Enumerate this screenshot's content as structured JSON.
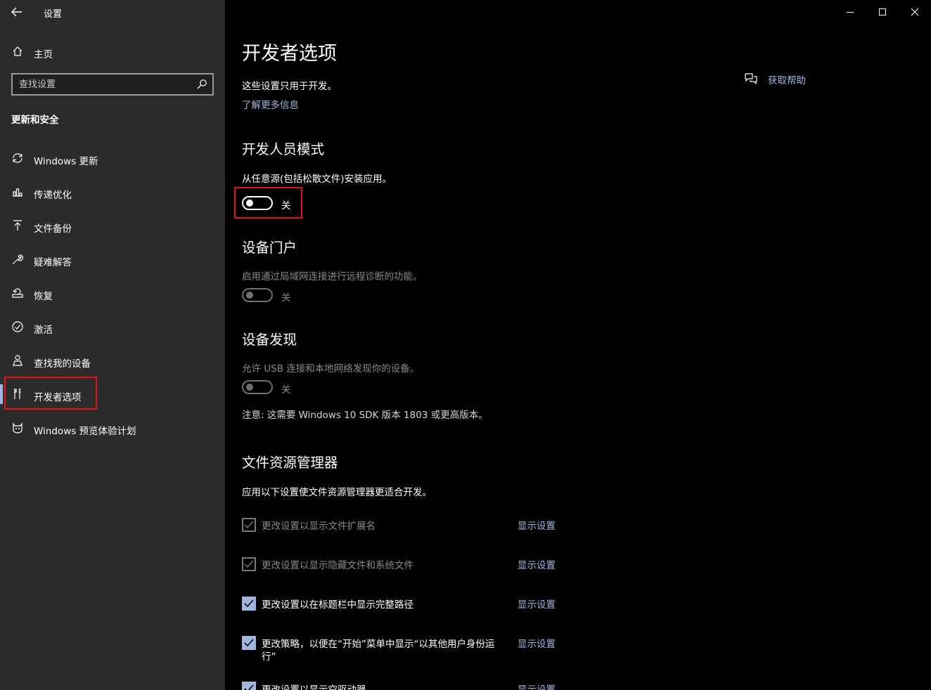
{
  "window": {
    "title": "设置",
    "back_icon": "arrow-left-icon",
    "controls": [
      "minimize-icon",
      "maximize-icon",
      "close-icon"
    ]
  },
  "sidebar": {
    "home_label": "主页",
    "search_placeholder": "查找设置",
    "section_title": "更新和安全",
    "items": [
      {
        "label": "Windows 更新",
        "icon": "sync-icon"
      },
      {
        "label": "传递优化",
        "icon": "delivery-optimization-icon"
      },
      {
        "label": "文件备份",
        "icon": "backup-arrow-up-icon"
      },
      {
        "label": "疑难解答",
        "icon": "wrench-icon"
      },
      {
        "label": "恢复",
        "icon": "recovery-icon"
      },
      {
        "label": "激活",
        "icon": "check-circle-icon"
      },
      {
        "label": "查找我的设备",
        "icon": "person-location-icon"
      },
      {
        "label": "开发者选项",
        "icon": "developer-tools-icon",
        "selected": true
      },
      {
        "label": "Windows 预览体验计划",
        "icon": "insider-cat-icon"
      }
    ]
  },
  "main": {
    "title": "开发者选项",
    "description": "这些设置只用于开发。",
    "learn_more": "了解更多信息",
    "help_link": "获取帮助",
    "developer_mode": {
      "title": "开发人员模式",
      "desc": "从任意源(包括松散文件)安装应用。",
      "toggle_state": "关",
      "enabled": true
    },
    "device_portal": {
      "title": "设备门户",
      "desc": "启用通过局域网连接进行远程诊断的功能。",
      "toggle_state": "关",
      "enabled": false
    },
    "device_discovery": {
      "title": "设备发现",
      "desc": "允许 USB 连接和本地网络发现你的设备。",
      "toggle_state": "关",
      "enabled": false,
      "note": "注意: 这需要 Windows 10 SDK 版本 1803 或更高版本。"
    },
    "file_explorer": {
      "title": "文件资源管理器",
      "desc": "应用以下设置使文件资源管理器更适合开发。",
      "show_settings_label": "显示设置",
      "options": [
        {
          "label": "更改设置以显示文件扩展名",
          "checked": true,
          "enabled": false
        },
        {
          "label": "更改设置以显示隐藏文件和系统文件",
          "checked": true,
          "enabled": false
        },
        {
          "label": "更改设置以在标题栏中显示完整路径",
          "checked": true,
          "enabled": true
        },
        {
          "label_line1": "更改策略，以便在“开始”菜单中显示“以其他用户身份运",
          "label_line2": "行”",
          "checked": true,
          "enabled": true
        },
        {
          "label": "更改设置以显示空驱动器",
          "checked": true,
          "enabled": true
        }
      ]
    }
  },
  "colors": {
    "sidebar_bg": "#2b2b2b",
    "main_bg": "#000000",
    "accent": "#9fb6de",
    "highlight_box": "#e0141e"
  }
}
